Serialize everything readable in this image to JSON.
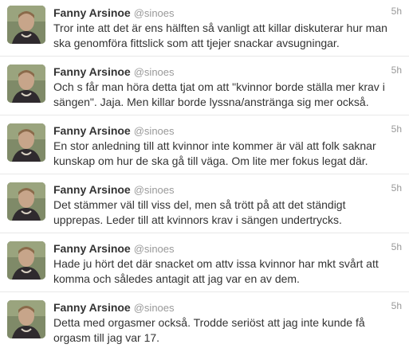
{
  "tweets": [
    {
      "name": "Fanny Arsinoe",
      "handle": "@sinoes",
      "time": "5h",
      "lines": [
        "Tror inte att det är ens hälften så vanligt att killar diskuterar hur man",
        "ska genomföra fittslick som att tjejer snackar avsugningar."
      ]
    },
    {
      "name": "Fanny Arsinoe",
      "handle": "@sinoes",
      "time": "5h",
      "lines": [
        "Och s får man höra detta tjat om att \"kvinnor borde ställa mer krav i",
        "sängen\". Jaja. Men killar borde lyssna/anstränga sig mer också."
      ]
    },
    {
      "name": "Fanny Arsinoe",
      "handle": "@sinoes",
      "time": "5h",
      "lines": [
        "En stor anledning till att kvinnor inte kommer är väl att folk saknar",
        "kunskap om hur de ska gå till väga. Om lite mer fokus legat där."
      ]
    },
    {
      "name": "Fanny Arsinoe",
      "handle": "@sinoes",
      "time": "5h",
      "lines": [
        "Det stämmer väl till viss del, men så trött på att det ständigt",
        "upprepas. Leder till att kvinnors krav i sängen undertrycks."
      ]
    },
    {
      "name": "Fanny Arsinoe",
      "handle": "@sinoes",
      "time": "5h",
      "lines": [
        "Hade ju hört det där snacket om attv issa kvinnor har mkt svårt att",
        "komma och således antagit att jag var en av dem."
      ]
    },
    {
      "name": "Fanny Arsinoe",
      "handle": "@sinoes",
      "time": "5h",
      "lines": [
        "Detta med orgasmer också. Trodde seriöst att jag inte kunde få",
        "orgasm till jag var 17."
      ]
    }
  ]
}
